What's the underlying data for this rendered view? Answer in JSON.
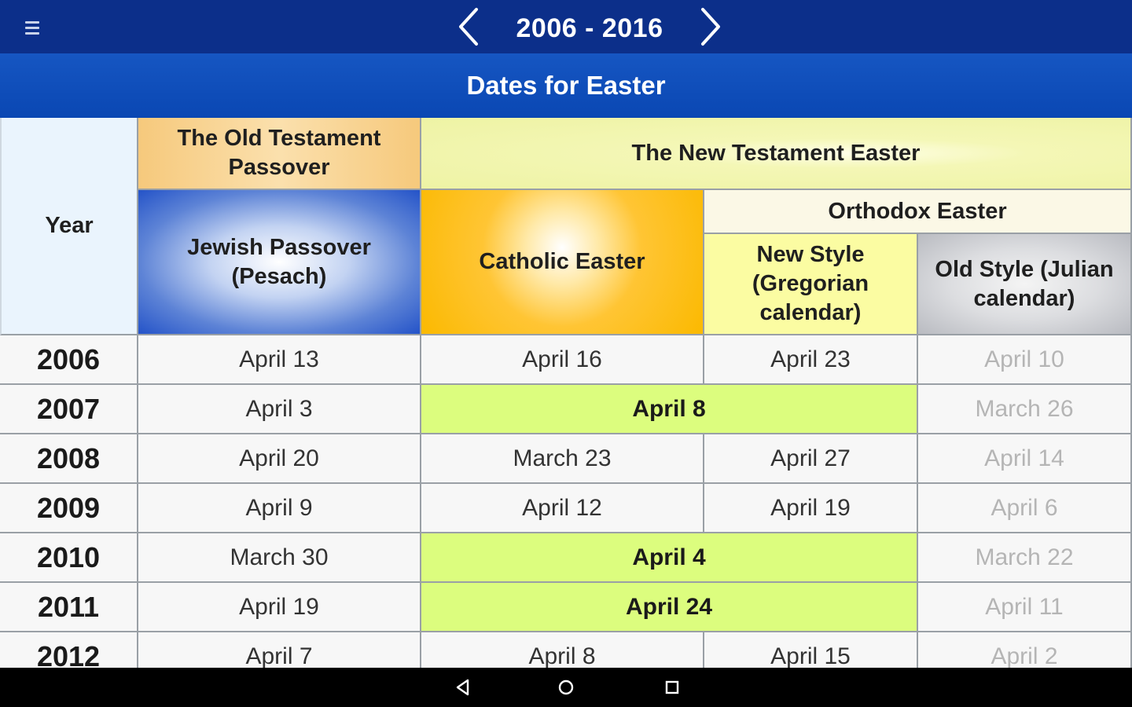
{
  "app_bar": {
    "menu_icon": "menu-icon",
    "prev_icon": "chevron-left-icon",
    "next_icon": "chevron-right-icon",
    "range": "2006 - 2016",
    "background": "#0c2f8a"
  },
  "title_bar": {
    "title": "Dates for Easter",
    "background": "#0a47b3"
  },
  "table": {
    "headers": {
      "year": "Year",
      "old_testament": "The Old Testament Passover",
      "new_testament": "The New Testament Easter",
      "jewish_passover": "Jewish Passover (Pesach)",
      "catholic_easter": "Catholic Easter",
      "orthodox_easter": "Orthodox Easter",
      "new_style": "New Style (Gregorian calendar)",
      "old_style": "Old Style (Julian calendar)"
    },
    "rows": [
      {
        "year": "2006",
        "passover": "April 13",
        "catholic": "April 16",
        "new_style": "April 23",
        "old_style": "April 10",
        "merged": false
      },
      {
        "year": "2007",
        "passover": "April 3",
        "catholic": "April 8",
        "new_style": "April 8",
        "old_style": "March 26",
        "merged": true
      },
      {
        "year": "2008",
        "passover": "April 20",
        "catholic": "March 23",
        "new_style": "April 27",
        "old_style": "April 14",
        "merged": false
      },
      {
        "year": "2009",
        "passover": "April 9",
        "catholic": "April 12",
        "new_style": "April 19",
        "old_style": "April 6",
        "merged": false
      },
      {
        "year": "2010",
        "passover": "March 30",
        "catholic": "April 4",
        "new_style": "April 4",
        "old_style": "March 22",
        "merged": true
      },
      {
        "year": "2011",
        "passover": "April 19",
        "catholic": "April 24",
        "new_style": "April 24",
        "old_style": "April 11",
        "merged": true
      },
      {
        "year": "2012",
        "passover": "April 7",
        "catholic": "April 8",
        "new_style": "April 15",
        "old_style": "April 2",
        "merged": false
      }
    ],
    "colors": {
      "merged_highlight": "#dcfd7e",
      "old_style_text": "#b5b5b5",
      "passover_header": "#2453c8",
      "catholic_header": "#fbb900",
      "new_style_header": "#fbfca2"
    }
  },
  "system_nav": {
    "back_icon": "back-triangle-icon",
    "home_icon": "home-circle-icon",
    "recent_icon": "recent-apps-square-icon"
  }
}
